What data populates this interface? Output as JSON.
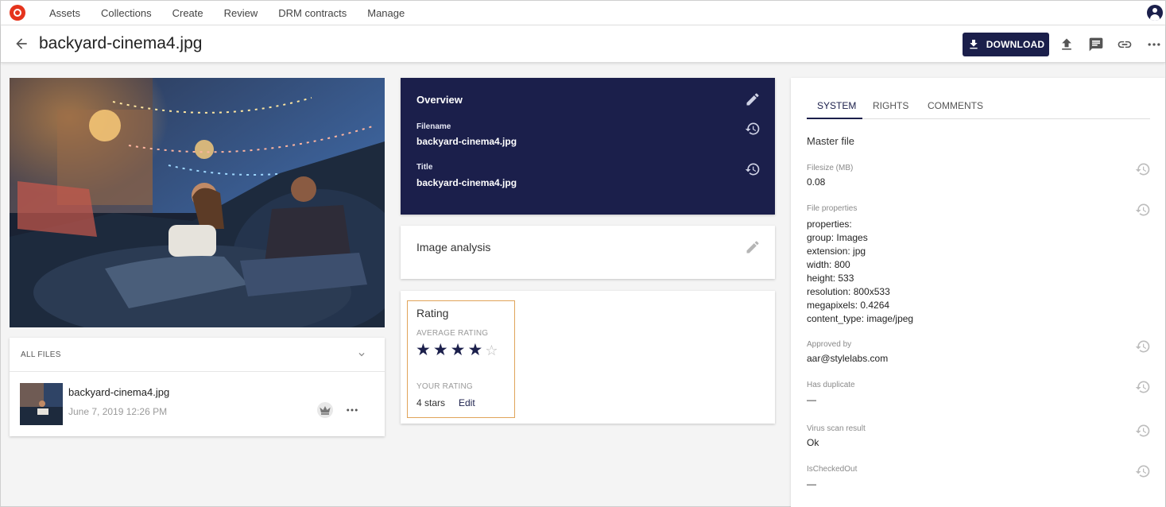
{
  "nav": {
    "items": [
      "Assets",
      "Collections",
      "Create",
      "Review",
      "DRM contracts",
      "Manage"
    ]
  },
  "header": {
    "title": "backyard-cinema4.jpg",
    "download_label": "DOWNLOAD"
  },
  "files": {
    "title": "ALL FILES",
    "items": [
      {
        "name": "backyard-cinema4.jpg",
        "date": "June 7, 2019 12:26 PM"
      }
    ]
  },
  "overview": {
    "title": "Overview",
    "filename_label": "Filename",
    "filename_value": "backyard-cinema4.jpg",
    "title_label": "Title",
    "title_value": "backyard-cinema4.jpg"
  },
  "analysis": {
    "title": "Image analysis"
  },
  "rating": {
    "title": "Rating",
    "average_label": "AVERAGE RATING",
    "average_stars": 4,
    "max_stars": 5,
    "your_label": "YOUR RATING",
    "your_value": "4 stars",
    "edit_label": "Edit"
  },
  "details": {
    "tabs": [
      "SYSTEM",
      "RIGHTS",
      "COMMENTS"
    ],
    "active_tab": "SYSTEM",
    "section_title": "Master file",
    "filesize_label": "Filesize (MB)",
    "filesize_value": "0.08",
    "file_properties_label": "File properties",
    "file_properties": [
      {
        "key": "properties:",
        "value": ""
      },
      {
        "key": "group:",
        "value": " Images"
      },
      {
        "key": "extension:",
        "value": " jpg"
      },
      {
        "key": "width:",
        "value": " 800"
      },
      {
        "key": "height:",
        "value": " 533"
      },
      {
        "key": "resolution:",
        "value": " 800x533"
      },
      {
        "key": "megapixels:",
        "value": " 0.4264"
      },
      {
        "key": "content_type:",
        "value": " image/jpeg"
      }
    ],
    "approved_label": "Approved by",
    "approved_value": "aar@stylelabs.com",
    "duplicate_label": "Has duplicate",
    "duplicate_value": "—",
    "virus_label": "Virus scan result",
    "virus_value": "Ok",
    "checkedout_label": "IsCheckedOut",
    "checkedout_value": "—"
  },
  "colors": {
    "brand_navy": "#1b1f4b",
    "logo_red": "#e5341d",
    "rating_border": "#e0a45a"
  }
}
